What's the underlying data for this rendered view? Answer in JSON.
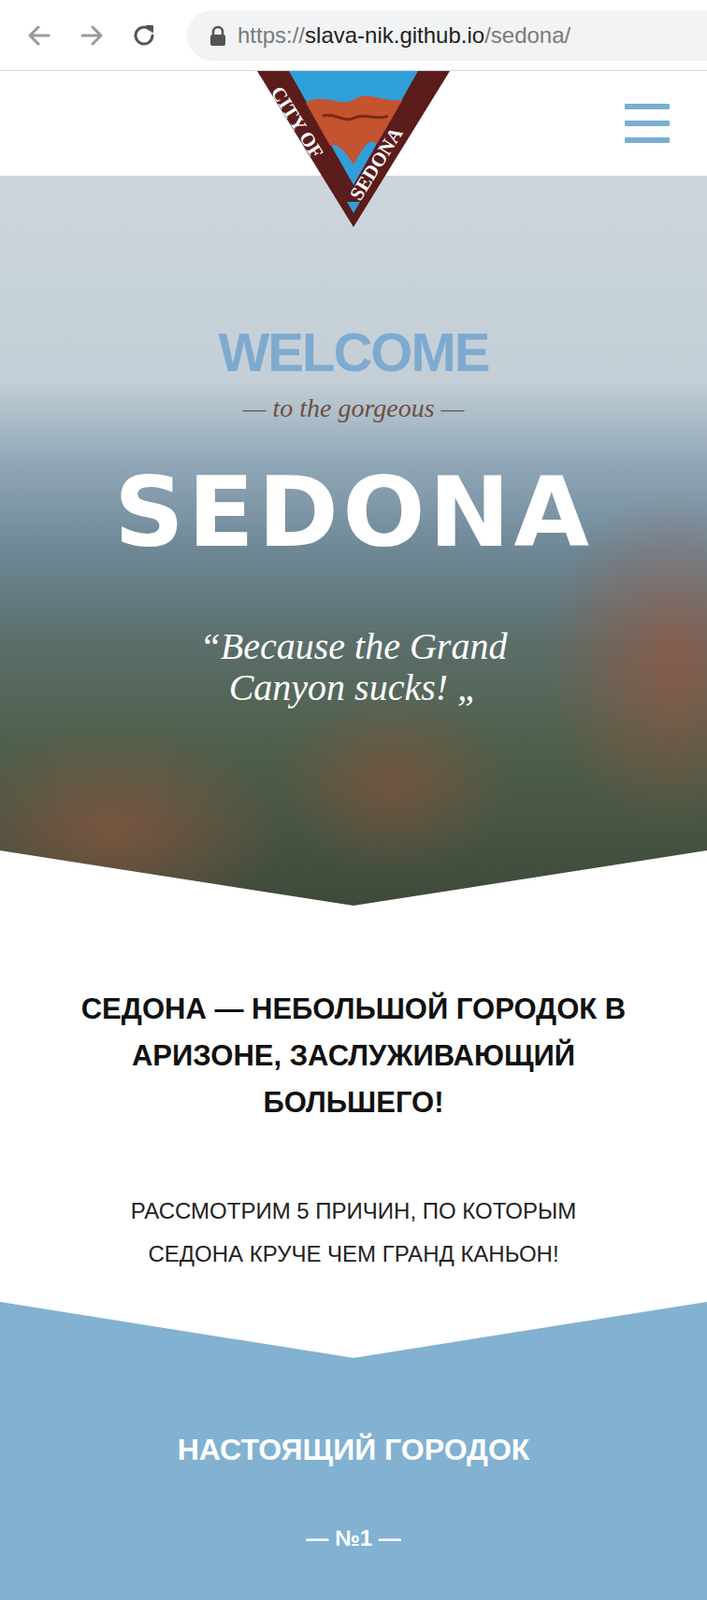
{
  "browser": {
    "url": {
      "scheme": "https://",
      "host": "slava-nik.github.io",
      "path": "/sedona/"
    }
  },
  "logo": {
    "left": "CITY OF",
    "right": "SEDONA"
  },
  "hero": {
    "welcome": "WELCOME",
    "subtitle": "— to the gorgeous —",
    "title": "SEDONA",
    "quote": "“Because the Grand Canyon sucks! „"
  },
  "intro": {
    "heading": "СЕДОНА — НЕБОЛЬШОЙ ГОРОДОК В АРИЗОНЕ, ЗАСЛУЖИВАЮЩИЙ БОЛЬШЕГО!",
    "text": "РАССМОТРИМ 5 ПРИЧИН, ПО КОТОРЫМ СЕДОНА КРУЧЕ ЧЕМ ГРАНД КАНЬОН!"
  },
  "reasons": [
    {
      "title": "НАСТОЯЩИЙ ГОРОДОК",
      "number": "— №1 —"
    }
  ]
}
